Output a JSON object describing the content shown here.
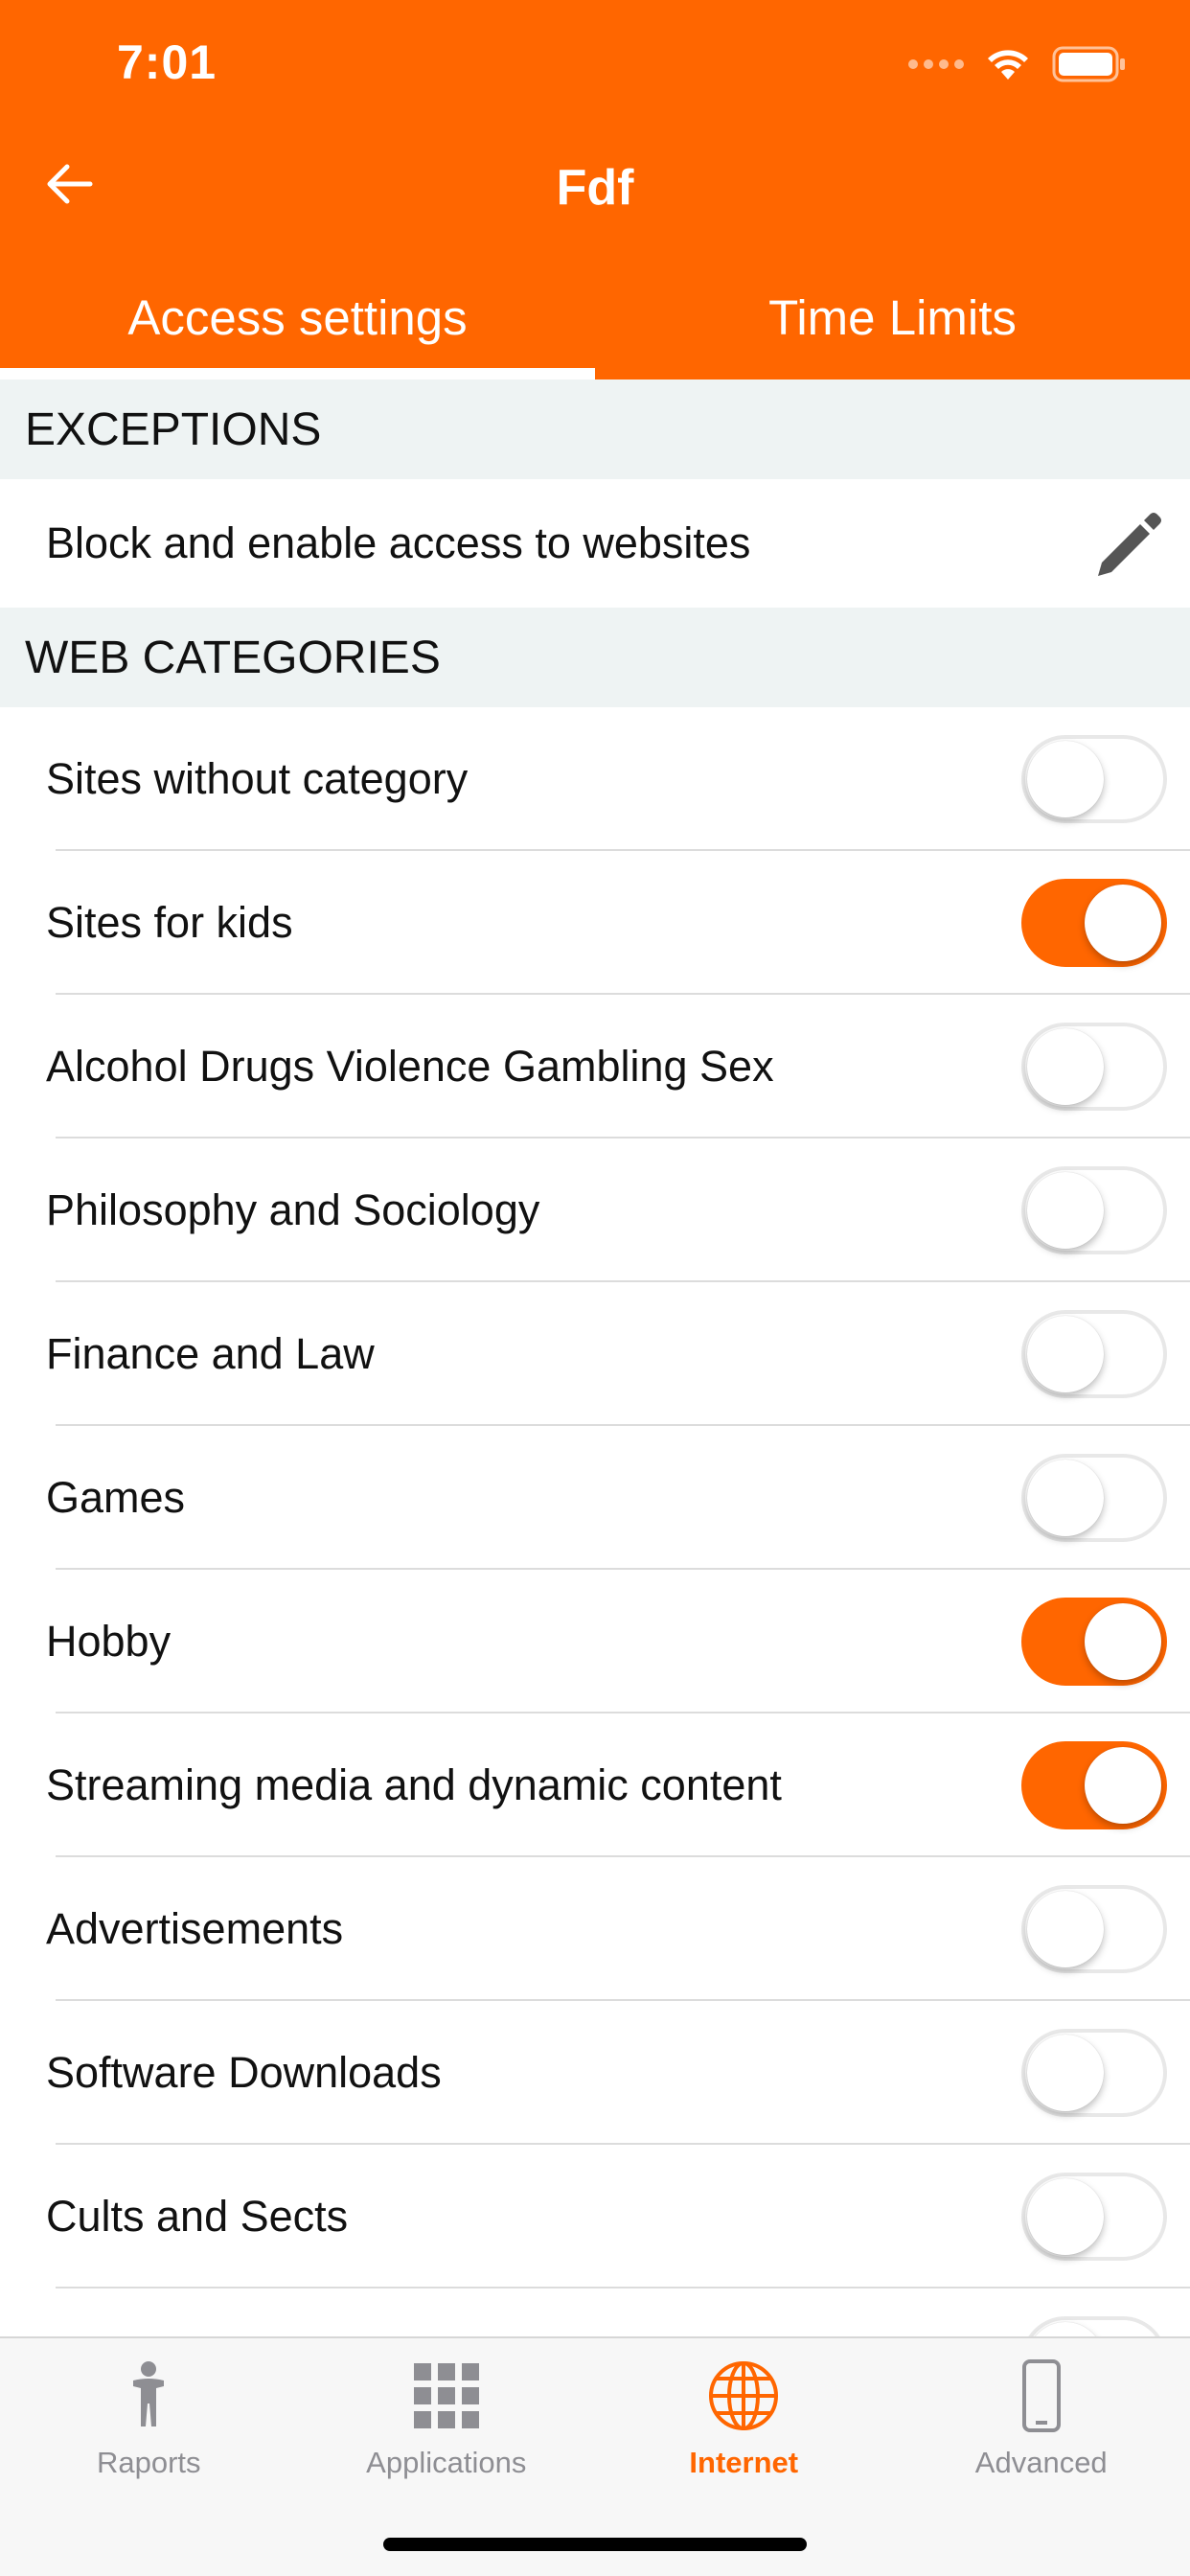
{
  "status_bar": {
    "time": "7:01"
  },
  "nav": {
    "title": "Fdf"
  },
  "tabs": [
    {
      "label": "Access settings",
      "active": true
    },
    {
      "label": "Time Limits",
      "active": false
    }
  ],
  "exceptions": {
    "header": "EXCEPTIONS",
    "row_label": "Block and enable access to websites",
    "icon": "pencil-icon"
  },
  "web_categories": {
    "header": "WEB CATEGORIES",
    "items": [
      {
        "label": "Sites without category",
        "enabled": false
      },
      {
        "label": "Sites for kids",
        "enabled": true
      },
      {
        "label": "Alcohol Drugs Violence Gambling Sex",
        "enabled": false
      },
      {
        "label": "Philosophy and Sociology",
        "enabled": false
      },
      {
        "label": "Finance and Law",
        "enabled": false
      },
      {
        "label": "Games",
        "enabled": false
      },
      {
        "label": "Hobby",
        "enabled": true
      },
      {
        "label": "Streaming media and dynamic content",
        "enabled": true
      },
      {
        "label": "Advertisements",
        "enabled": false
      },
      {
        "label": "Software Downloads",
        "enabled": false
      },
      {
        "label": "Cults and Sects",
        "enabled": false
      },
      {
        "label": "",
        "enabled": false
      }
    ]
  },
  "tabbar": {
    "items": [
      {
        "label": "Raports",
        "icon": "person-icon",
        "active": false
      },
      {
        "label": "Applications",
        "icon": "grid-icon",
        "active": false
      },
      {
        "label": "Internet",
        "icon": "globe-icon",
        "active": true
      },
      {
        "label": "Advanced",
        "icon": "phone-icon",
        "active": false
      }
    ]
  },
  "colors": {
    "accent": "#FF6600",
    "section_bg": "#EEF3F3",
    "inactive": "#8E8E93"
  }
}
